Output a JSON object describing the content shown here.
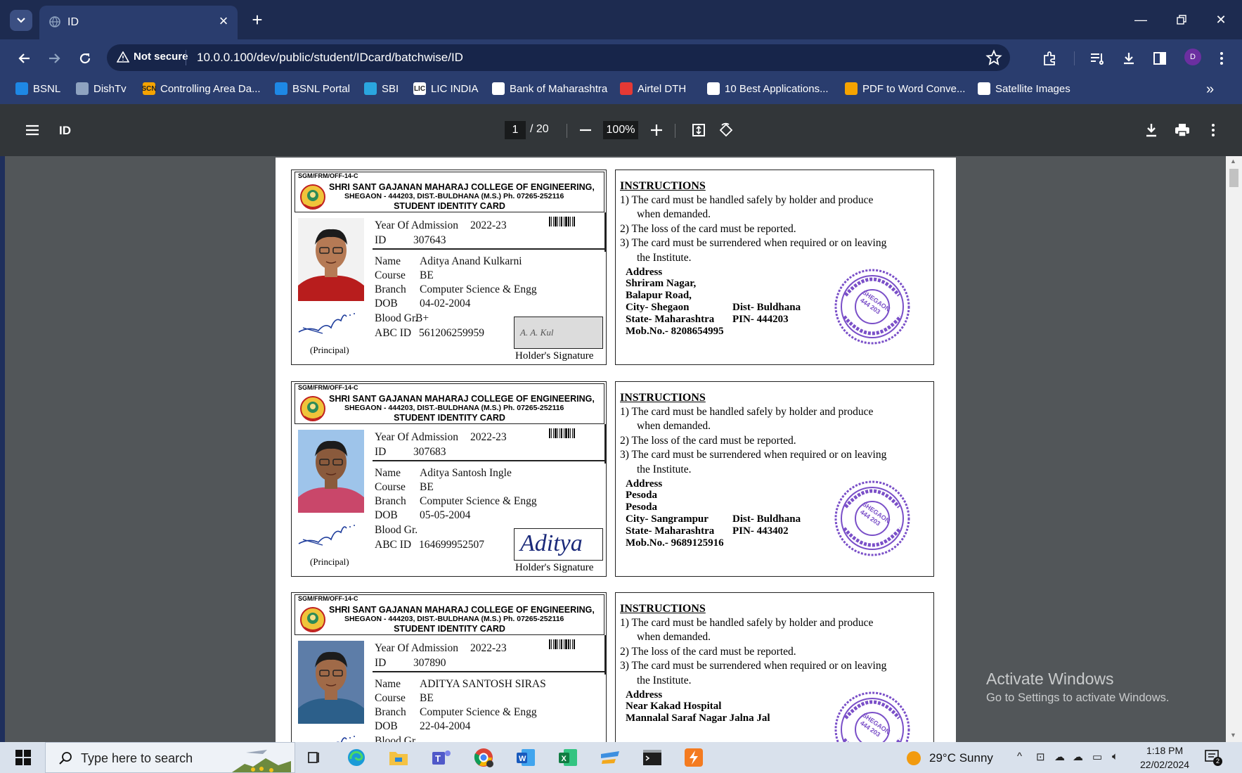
{
  "browser": {
    "tab_title": "ID",
    "new_tab_icon": "plus-icon",
    "url": "10.0.0.100/dev/public/student/IDcard/batchwise/ID",
    "security_label": "Not secure",
    "profile_initial": "D"
  },
  "bookmarks": [
    {
      "label": "BSNL",
      "color": "#1e88e5",
      "icon_text": ""
    },
    {
      "label": "DishTv",
      "color": "#8fa3c0",
      "icon_text": ""
    },
    {
      "label": "Controlling Area Da...",
      "color": "#f5a300",
      "icon_text": "SCN"
    },
    {
      "label": "BSNL Portal",
      "color": "#1e88e5",
      "icon_text": ""
    },
    {
      "label": "SBI",
      "color": "#2aa6df",
      "icon_text": ""
    },
    {
      "label": "LIC INDIA",
      "color": "#ffffff",
      "icon_text": "LIC"
    },
    {
      "label": "Bank of Maharashtra",
      "color": "#ffffff",
      "icon_text": ""
    },
    {
      "label": "Airtel DTH",
      "color": "#e53935",
      "icon_text": ""
    },
    {
      "label": "10 Best Applications...",
      "color": "#ffffff",
      "icon_text": ""
    },
    {
      "label": "PDF to Word Conve...",
      "color": "#f5a300",
      "icon_text": ""
    },
    {
      "label": "Satellite Images",
      "color": "#ffffff",
      "icon_text": ""
    }
  ],
  "pdf": {
    "title": "ID",
    "current_page": "1",
    "total_pages": "/ 20",
    "zoom": "100%"
  },
  "card_template": {
    "form_code": "SGM/FRM/OFF-14-C",
    "college": "SHRI SANT GAJANAN MAHARAJ COLLEGE OF ENGINEERING,",
    "address": "SHEGAON - 444203, DIST.-BULDHANA (M.S.) Ph. 07265-252116",
    "card_title": "STUDENT IDENTITY CARD",
    "lbl_year": "Year Of Admission",
    "lbl_id": "ID",
    "lbl_name": "Name",
    "lbl_course": "Course",
    "lbl_branch": "Branch",
    "lbl_dob": "DOB",
    "lbl_blood": "Blood Gr.",
    "lbl_abc": "ABC ID",
    "principal": "(Principal)",
    "holder_sig": "Holder's Signature",
    "instructions_title": "INSTRUCTIONS",
    "instructions": [
      "1)   The card must be handled safely by holder and produce",
      "when demanded.",
      "2)   The loss of the card must be reported.",
      "3)   The card must be surrendered when required or on leaving",
      "the Institute."
    ],
    "address_title": "Address",
    "stamp_text": "SHEGAON 444 203"
  },
  "students": [
    {
      "year": "2022-23",
      "id": "307643",
      "name": "Aditya Anand Kulkarni",
      "course": "BE",
      "branch": "Computer Science & Engg",
      "dob": "04-02-2004",
      "blood": "B+",
      "abc": "561206259959",
      "signature": "A. A. Kul",
      "address_lines": [
        "Shriram Nagar,",
        "Balapur Road,"
      ],
      "city": "City-  Shegaon",
      "dist": "Dist-  Buldhana",
      "state": "State- Maharashtra",
      "pin": "PIN-  444203",
      "mob": "Mob.No.- 8208654995",
      "photo_bg": "#f2f2f2",
      "shirt": "#b81d1d",
      "skin": "#b57a55"
    },
    {
      "year": "2022-23",
      "id": "307683",
      "name": "Aditya Santosh Ingle",
      "course": "BE",
      "branch": "Computer Science & Engg",
      "dob": "05-05-2004",
      "blood": "",
      "abc": "164699952507",
      "signature": "Aditya",
      "address_lines": [
        "Pesoda",
        "Pesoda"
      ],
      "city": "City-  Sangrampur",
      "dist": "Dist-  Buldhana",
      "state": "State- Maharashtra",
      "pin": "PIN-  443402",
      "mob": "Mob.No.- 9689125916",
      "photo_bg": "#9ec4ea",
      "shirt": "#c9476a",
      "skin": "#8a5a3c"
    },
    {
      "year": "2022-23",
      "id": "307890",
      "name": "ADITYA SANTOSH SIRAS",
      "course": "BE",
      "branch": "Computer Science & Engg",
      "dob": "22-04-2004",
      "blood": "",
      "abc": "",
      "signature": "",
      "address_lines": [
        "Near Kakad Hospital",
        "Mannalal Saraf Nagar Jalna Jal"
      ],
      "city": "",
      "dist": "",
      "state": "",
      "pin": "",
      "mob": "",
      "photo_bg": "#5d7da8",
      "shirt": "#2c5f8a",
      "skin": "#a06a48"
    }
  ],
  "watermark": {
    "title": "Activate Windows",
    "subtitle": "Go to Settings to activate Windows."
  },
  "taskbar": {
    "search_placeholder": "Type here to search",
    "weather": "29°C  Sunny",
    "time": "1:18 PM",
    "date": "22/02/2024",
    "notification_count": "2"
  }
}
